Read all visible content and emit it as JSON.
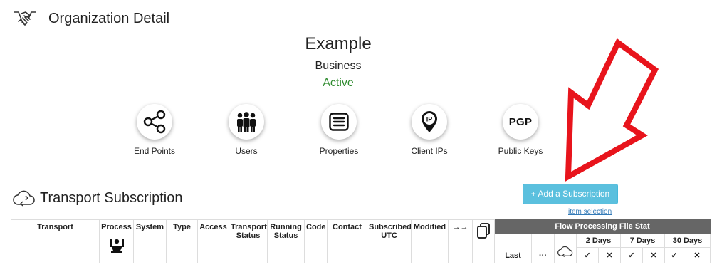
{
  "header": {
    "title": "Organization Detail",
    "icon": "handshake-icon"
  },
  "organization": {
    "name": "Example",
    "type": "Business",
    "status": "Active",
    "status_color": "#2e8b2e"
  },
  "nav": [
    {
      "label": "End Points",
      "icon": "share-nodes-icon"
    },
    {
      "label": "Users",
      "icon": "users-group-icon"
    },
    {
      "label": "Properties",
      "icon": "list-box-icon"
    },
    {
      "label": "Client IPs",
      "icon": "ip-pin-icon",
      "icon_text": "IP"
    },
    {
      "label": "Public Keys",
      "icon": "pgp-icon",
      "icon_text": "PGP"
    }
  ],
  "subscription": {
    "title": "Transport Subscription",
    "add_button": "+ Add a Subscription",
    "item_selection": "item selection",
    "button_color": "#5bc0de"
  },
  "table": {
    "columns": [
      "Transport",
      "Process",
      "System",
      "Type",
      "Access",
      "Transport Status",
      "Running Status",
      "Code",
      "Contact",
      "Subscribed UTC",
      "Modified",
      "→→"
    ],
    "flow_header": "Flow Processing File Stat",
    "flow_groups": [
      "2 Days",
      "7 Days",
      "30 Days"
    ],
    "flow_sub": {
      "last": "Last",
      "more": "···",
      "check": "✓",
      "cross": "✕"
    }
  },
  "annotation": {
    "arrow_color": "#e8141c"
  }
}
